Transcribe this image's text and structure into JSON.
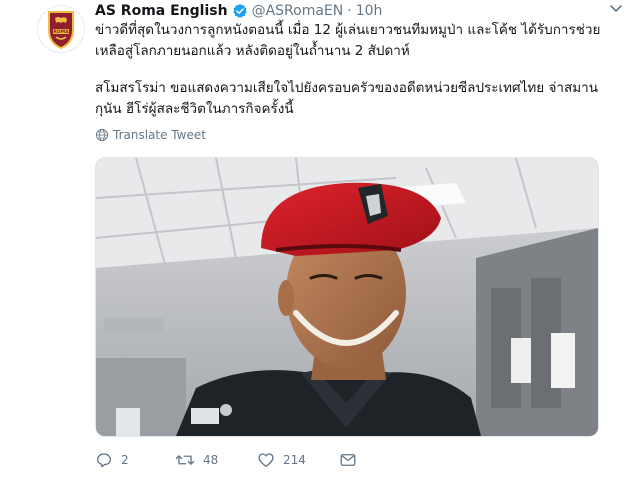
{
  "account": {
    "display_name": "AS Roma English",
    "handle": "@ASRomaEN",
    "separator": "·",
    "time": "10h",
    "logo_text": "ROMA"
  },
  "tweet": {
    "paragraph_1": "ข่าวดีที่สุดในวงการลูกหนังตอนนี้ เมื่อ 12 ผู้เล่นเยาวชนทีมหมูป่า และโค้ช ได้รับการช่วยเหลือสู่โลกภายนอกแล้ว หลังติดอยู่ในถ้ำนาน 2 สัปดาห์",
    "paragraph_2": "สโมสรโรม่า ขอแสดงความเสียใจไปยังครอบครัวของอดีตหน่วยซีลประเทศไทย จ่าสมาน กุนัน ฮีโร่ผู้สละชีวิตในภารกิจครั้งนี้",
    "translate_label": "Translate Tweet"
  },
  "actions": {
    "reply_count": "2",
    "retweet_count": "48",
    "like_count": "214"
  },
  "colors": {
    "text": "#14171a",
    "secondary": "#657786",
    "verified": "#1da1f2",
    "roma_red": "#8e1f2f",
    "roma_gold": "#f0bc42"
  },
  "icons": {
    "verified": "verified-badge-icon",
    "chevron": "chevron-down-icon",
    "translate": "globe-icon",
    "reply": "reply-icon",
    "retweet": "retweet-icon",
    "like": "heart-icon",
    "message": "direct-message-icon"
  }
}
